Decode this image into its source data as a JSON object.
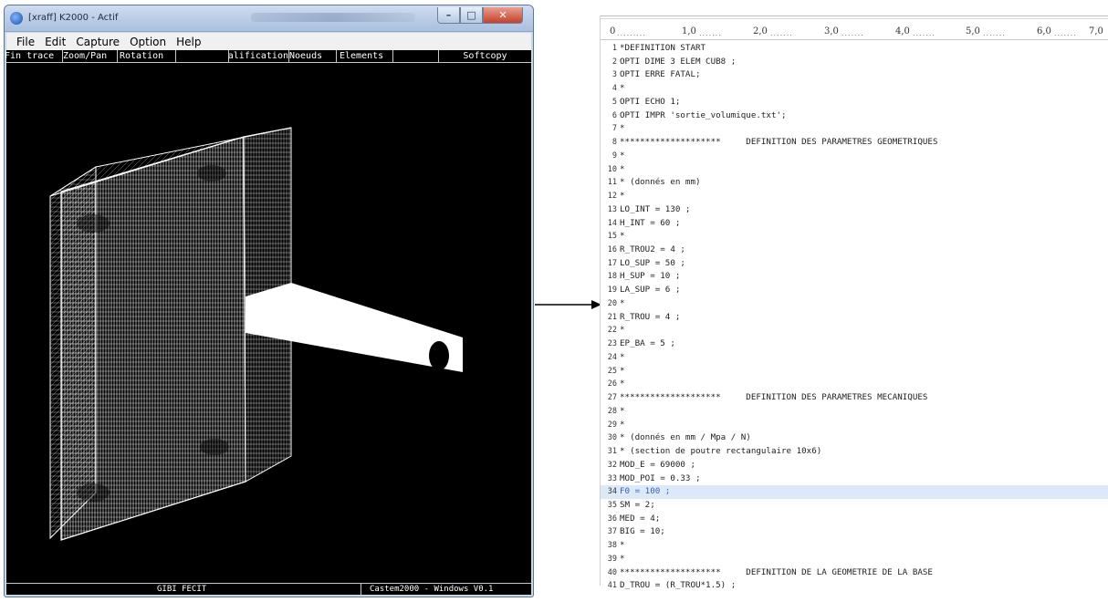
{
  "left_window": {
    "title": "[xraff] K2000 - Actif",
    "menu": [
      "File",
      "Edit",
      "Capture",
      "Option",
      "Help"
    ],
    "toolbar": [
      "Fin trace",
      "Zoom/Pan",
      "Rotation",
      "",
      "Qualification",
      "Noeuds",
      "Elements",
      "",
      "Softcopy"
    ],
    "status_left": "GIBI FECIT",
    "status_right": "Castem2000 - Windows  V0.1",
    "icons": {
      "app": "app-icon",
      "minimize": "minimize-icon",
      "maximize": "maximize-icon",
      "close": "close-icon"
    }
  },
  "arrow": {
    "icon": "right-arrow-icon"
  },
  "editor": {
    "ruler": [
      "0",
      "1,0",
      "2,0",
      "3,0",
      "4,0",
      "5,0",
      "6,0",
      "7,0"
    ],
    "highlighted_line": 34,
    "lines": [
      {
        "n": "1",
        "text": "*DEFINITION START"
      },
      {
        "n": "2",
        "text": "OPTI DIME 3 ELEM CUB8 ;"
      },
      {
        "n": "3",
        "text": "OPTI ERRE FATAL;"
      },
      {
        "n": "4",
        "text": "*"
      },
      {
        "n": "5",
        "text": "OPTI ECHO 1;"
      },
      {
        "n": "6",
        "text": "OPTI IMPR 'sortie_volumique.txt';"
      },
      {
        "n": "7",
        "text": "*"
      },
      {
        "n": "8",
        "text": "********************     DEFINITION DES PARAMETRES GEOMETRIQUES"
      },
      {
        "n": "9",
        "text": "*"
      },
      {
        "n": "10",
        "text": "*"
      },
      {
        "n": "11",
        "text": "* (donnés en mm)"
      },
      {
        "n": "12",
        "text": "*"
      },
      {
        "n": "13",
        "text": "LO_INT = 130 ;"
      },
      {
        "n": "14",
        "text": "H_INT = 60 ;"
      },
      {
        "n": "15",
        "text": "*"
      },
      {
        "n": "16",
        "text": "R_TROU2 = 4 ;"
      },
      {
        "n": "17",
        "text": "LO_SUP = 50 ;"
      },
      {
        "n": "18",
        "text": "H_SUP = 10 ;"
      },
      {
        "n": "19",
        "text": "LA_SUP = 6 ;"
      },
      {
        "n": "20",
        "text": "*"
      },
      {
        "n": "21",
        "text": "R_TROU = 4 ;"
      },
      {
        "n": "22",
        "text": "*"
      },
      {
        "n": "23",
        "text": "EP_BA = 5 ;"
      },
      {
        "n": "24",
        "text": "*"
      },
      {
        "n": "25",
        "text": "*"
      },
      {
        "n": "26",
        "text": "*"
      },
      {
        "n": "27",
        "text": "********************     DEFINITION DES PARAMETRES MECANIQUES"
      },
      {
        "n": "28",
        "text": "*"
      },
      {
        "n": "29",
        "text": "*"
      },
      {
        "n": "30",
        "text": "* (donnés en mm / Mpa / N)"
      },
      {
        "n": "31",
        "text": "* (section de poutre rectangulaire 10x6)"
      },
      {
        "n": "32",
        "text": "MOD_E = 69000 ;"
      },
      {
        "n": "33",
        "text": "MOD_POI = 0.33 ;"
      },
      {
        "n": "34",
        "text": "F0 = 100 ;"
      },
      {
        "n": "35",
        "text": "SM = 2;"
      },
      {
        "n": "36",
        "text": "MED = 4;"
      },
      {
        "n": "37",
        "text": "BIG = 10;"
      },
      {
        "n": "38",
        "text": "*"
      },
      {
        "n": "39",
        "text": "*"
      },
      {
        "n": "40",
        "text": "********************     DEFINITION DE LA GEOMETRIE DE LA BASE"
      },
      {
        "n": "41",
        "text": "D_TROU = (R_TROU*1.5) ;"
      }
    ]
  }
}
